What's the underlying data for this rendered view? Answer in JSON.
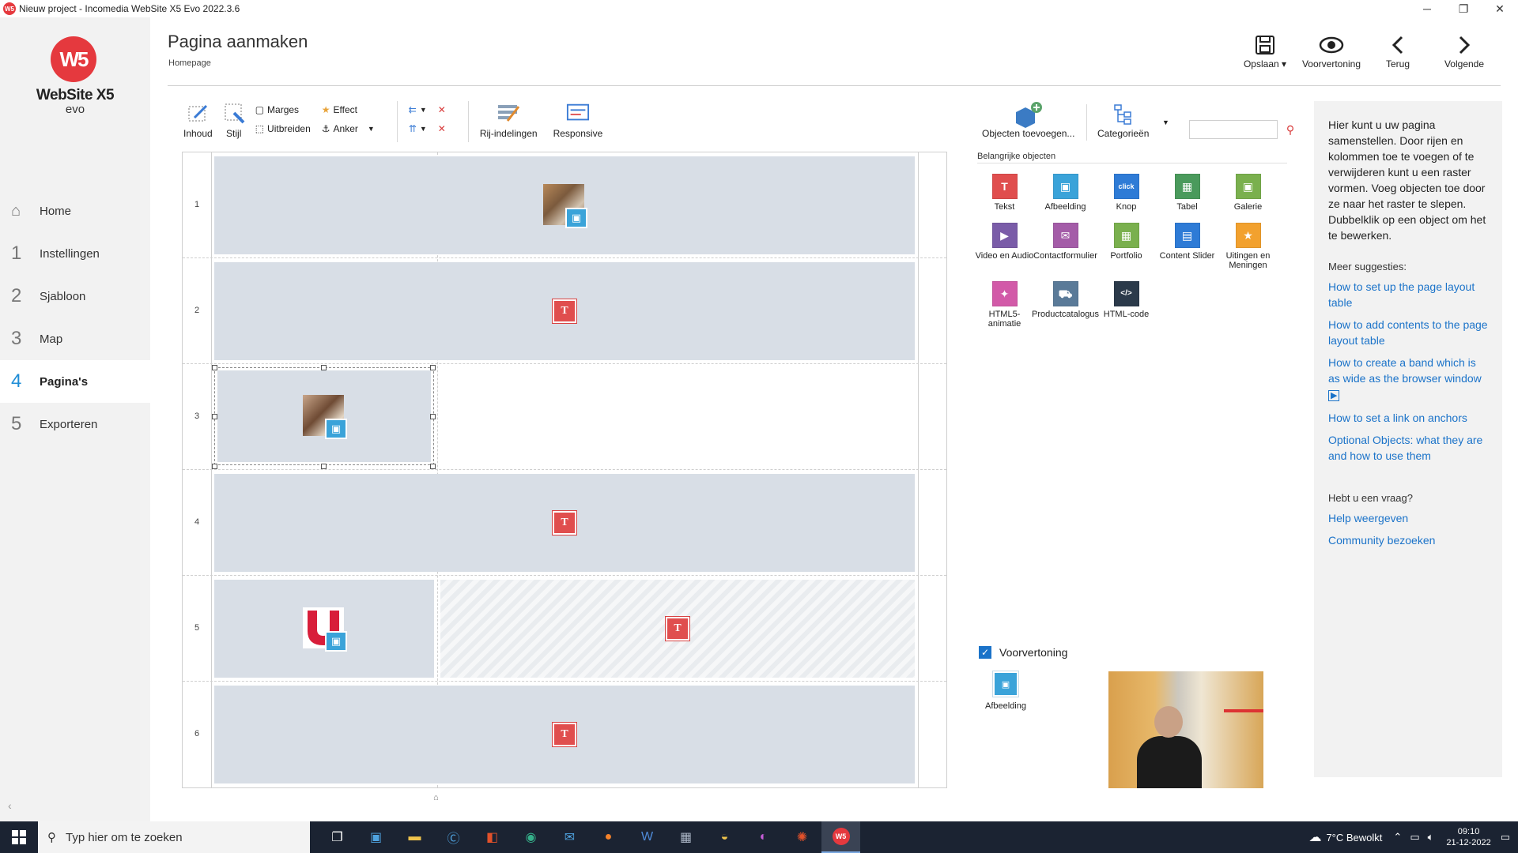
{
  "window": {
    "title": "Nieuw project - Incomedia WebSite X5 Evo 2022.3.6",
    "app_icon": "W5"
  },
  "sidebar": {
    "logo_mark": "W5",
    "logo_text": "WebSite X5",
    "logo_sub": "evo",
    "items": [
      {
        "num": "",
        "label": "Home",
        "icon": "home-icon"
      },
      {
        "num": "1",
        "label": "Instellingen"
      },
      {
        "num": "2",
        "label": "Sjabloon"
      },
      {
        "num": "3",
        "label": "Map"
      },
      {
        "num": "4",
        "label": "Pagina's",
        "active": true
      },
      {
        "num": "5",
        "label": "Exporteren"
      }
    ]
  },
  "header": {
    "title": "Pagina aanmaken",
    "subtitle": "Homepage",
    "actions": [
      {
        "label": "Opslaan ▾",
        "icon": "save-icon"
      },
      {
        "label": "Voorvertoning",
        "icon": "eye-icon"
      },
      {
        "label": "Terug",
        "icon": "chevron-left-icon"
      },
      {
        "label": "Volgende",
        "icon": "chevron-right-icon"
      }
    ]
  },
  "toolbar": {
    "inhoud": "Inhoud",
    "stijl": "Stijl",
    "marges": "Marges",
    "uitbreiden": "Uitbreiden",
    "effect": "Effect",
    "anker": "Anker",
    "rij_indelingen": "Rij-indelingen",
    "responsive": "Responsive"
  },
  "grid": {
    "rows": [
      "1",
      "2",
      "3",
      "4",
      "5",
      "6"
    ]
  },
  "objects": {
    "add_label": "Objecten toevoegen...",
    "categories_label": "Categorieën",
    "search_value": "",
    "section_title": "Belangrijke objecten",
    "items": [
      {
        "label": "Tekst",
        "color": "#e04e4e",
        "glyph": "T"
      },
      {
        "label": "Afbeelding",
        "color": "#3aa3d9",
        "glyph": "▣"
      },
      {
        "label": "Knop",
        "color": "#2e7bd6",
        "glyph": "click"
      },
      {
        "label": "Tabel",
        "color": "#4a9a5c",
        "glyph": "▦"
      },
      {
        "label": "Galerie",
        "color": "#7ab04e",
        "glyph": "▣"
      },
      {
        "label": "Video en Audio",
        "color": "#7a5ca8",
        "glyph": "▶"
      },
      {
        "label": "Contactformulier",
        "color": "#a45ca8",
        "glyph": "✉"
      },
      {
        "label": "Portfolio",
        "color": "#7ab04e",
        "glyph": "▦"
      },
      {
        "label": "Content Slider",
        "color": "#2e7bd6",
        "glyph": "▤"
      },
      {
        "label": "Uitingen en Meningen",
        "color": "#f2a12e",
        "glyph": "★"
      },
      {
        "label": "HTML5-animatie",
        "color": "#d25aa8",
        "glyph": "✦"
      },
      {
        "label": "Productcatalogus",
        "color": "#5a7a98",
        "glyph": "⛟"
      },
      {
        "label": "HTML-code",
        "color": "#2b3a4a",
        "glyph": "</>"
      }
    ]
  },
  "preview": {
    "checkbox_label": "Voorvertoning",
    "checked": true,
    "object_label": "Afbeelding"
  },
  "help": {
    "intro": "Hier kunt u uw pagina samenstellen. Door rijen en kolommen toe te voegen of te verwijderen kunt u een raster vormen. Voeg objecten toe door ze naar het raster te slepen. Dubbelklik op een object om het te bewerken.",
    "suggestions_heading": "Meer suggesties:",
    "links": [
      "How to set up the page layout table",
      "How to add contents to the page layout table",
      "How to create a band which is as wide as the browser window",
      "How to set a link on anchors",
      "Optional Objects: what they are and how to use them"
    ],
    "question_heading": "Hebt u een vraag?",
    "help_links": [
      "Help weergeven",
      "Community bezoeken"
    ]
  },
  "taskbar": {
    "search_placeholder": "Typ hier om te zoeken",
    "weather": "7°C  Bewolkt",
    "time": "09:10",
    "date": "21-12-2022"
  }
}
